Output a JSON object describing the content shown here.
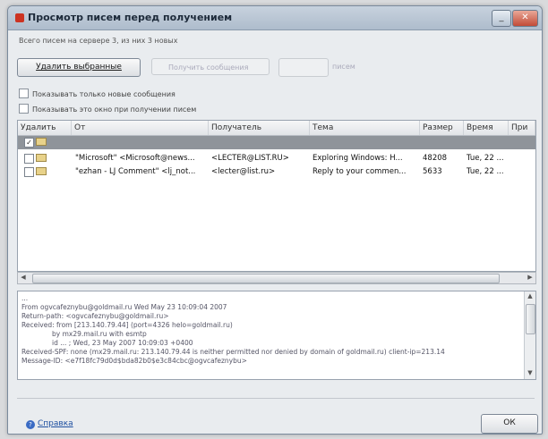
{
  "window": {
    "title": "Просмотр писем перед получением",
    "minimize_glyph": "_",
    "close_glyph": "✕",
    "info": "Всего писем на сервере 3, из них 3 новых"
  },
  "toolbar": {
    "delete_selected_label": "Удалить выбранные",
    "disabled_1": "Получить сообщения",
    "disabled_2": "",
    "disabled_3": "писем"
  },
  "options": {
    "only_new_label": "Показывать только новые сообщения",
    "show_window_label": "Показывать это окно при получении писем"
  },
  "grid": {
    "columns": [
      "Удалить",
      "От",
      "Получатель",
      "Тема",
      "Размер",
      "Время",
      "При"
    ],
    "rows": [
      {
        "checked": true,
        "selected": true,
        "check_glyph": "✓",
        "from": "",
        "to": "",
        "subject": "",
        "size": "",
        "time": ""
      },
      {
        "checked": false,
        "selected": false,
        "check_glyph": "",
        "from": "\"Microsoft\" <Microsoft@news...",
        "to": "<LECTER@LIST.RU>",
        "subject": "Exploring Windows: H...",
        "size": "48208",
        "time": "Tue, 22 ..."
      },
      {
        "checked": false,
        "selected": false,
        "check_glyph": "",
        "from": "\"ezhan - LJ Comment\" <lj_not...",
        "to": "<lecter@list.ru>",
        "subject": "Reply to your commen...",
        "size": "5633",
        "time": "Tue, 22 ..."
      }
    ]
  },
  "scroll": {
    "left_arrow": "◀",
    "right_arrow": "▶",
    "up_arrow": "▲",
    "down_arrow": "▼"
  },
  "headers_panel": {
    "lines": [
      "...",
      "From ogvcafeznybu@goldmail.ru Wed May 23 10:09:04 2007",
      "Return-path: <ogvcafeznybu@goldmail.ru>",
      "Received: from [213.140.79.44] (port=4326 helo=goldmail.ru)",
      "by mx29.mail.ru with esmtp",
      "id ... ; Wed, 23 May 2007 10:09:03 +0400",
      "Received-SPF: none (mx29.mail.ru: 213.140.79.44 is neither permitted nor denied by domain of goldmail.ru) client-ip=213.14",
      "Message-ID: <e7f18fc79d0d$bda82b0$e3c84cbc@ogvcafeznybu>"
    ]
  },
  "footer": {
    "help_icon_glyph": "?",
    "help_label": "Справка",
    "ok_label": "ОК"
  },
  "colors": {
    "selected_row": "#8f949a",
    "link": "#1e4fa0"
  }
}
